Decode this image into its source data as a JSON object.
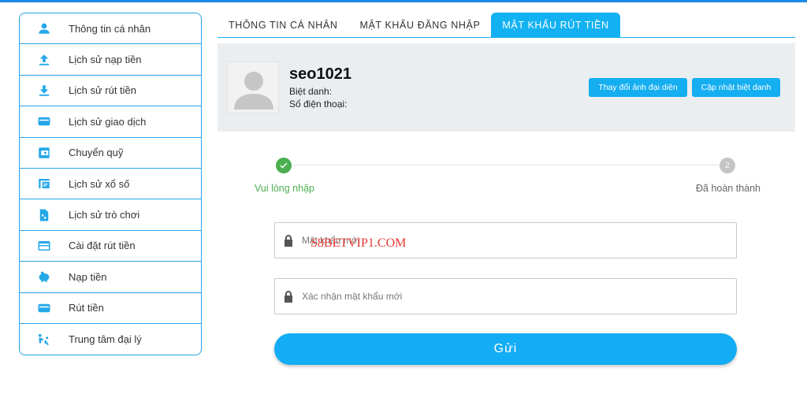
{
  "sidebar": {
    "items": [
      {
        "label": "Thông tin cá nhân",
        "icon": "user-icon"
      },
      {
        "label": "Lịch sử nạp tiền",
        "icon": "upload-icon"
      },
      {
        "label": "Lịch sử rút tiền",
        "icon": "download-icon"
      },
      {
        "label": "Lịch sử giao dịch",
        "icon": "wallet-icon"
      },
      {
        "label": "Chuyển quỹ",
        "icon": "transfer-icon"
      },
      {
        "label": "Lịch sử xổ số",
        "icon": "lottery-icon"
      },
      {
        "label": "Lịch sử trò chơi",
        "icon": "game-icon"
      },
      {
        "label": "Cài đặt rút tiền",
        "icon": "card-icon"
      },
      {
        "label": "Nạp tiền",
        "icon": "piggy-bank-icon"
      },
      {
        "label": "Rút tiền",
        "icon": "wallet-icon"
      },
      {
        "label": "Trung tâm đại lý",
        "icon": "agent-icon"
      }
    ]
  },
  "tabs": [
    {
      "label": "THÔNG TIN CÁ NHÂN",
      "active": false
    },
    {
      "label": "MẬT KHẨU ĐĂNG NHẬP",
      "active": false
    },
    {
      "label": "MẬT KHẨU RÚT TIỀN",
      "active": true
    }
  ],
  "profile": {
    "username": "seo1021",
    "nickname_label": "Biệt danh:",
    "phone_label": "Số điện thoại:",
    "change_avatar_button": "Thay đổi ảnh đại diện",
    "update_nickname_button": "Cập nhật biệt danh"
  },
  "steps": {
    "step1_label": "Vui lòng nhập",
    "step2_label": "Đã hoàn thành",
    "step2_number": "2"
  },
  "form": {
    "new_password_placeholder": "Mật khẩu mới",
    "confirm_password_placeholder": "Xác nhận mật khẩu mới",
    "submit_label": "Gửi",
    "watermark": "S8BETVIP1.COM"
  },
  "colors": {
    "accent": "#12b1f2",
    "success": "#4caf50"
  }
}
